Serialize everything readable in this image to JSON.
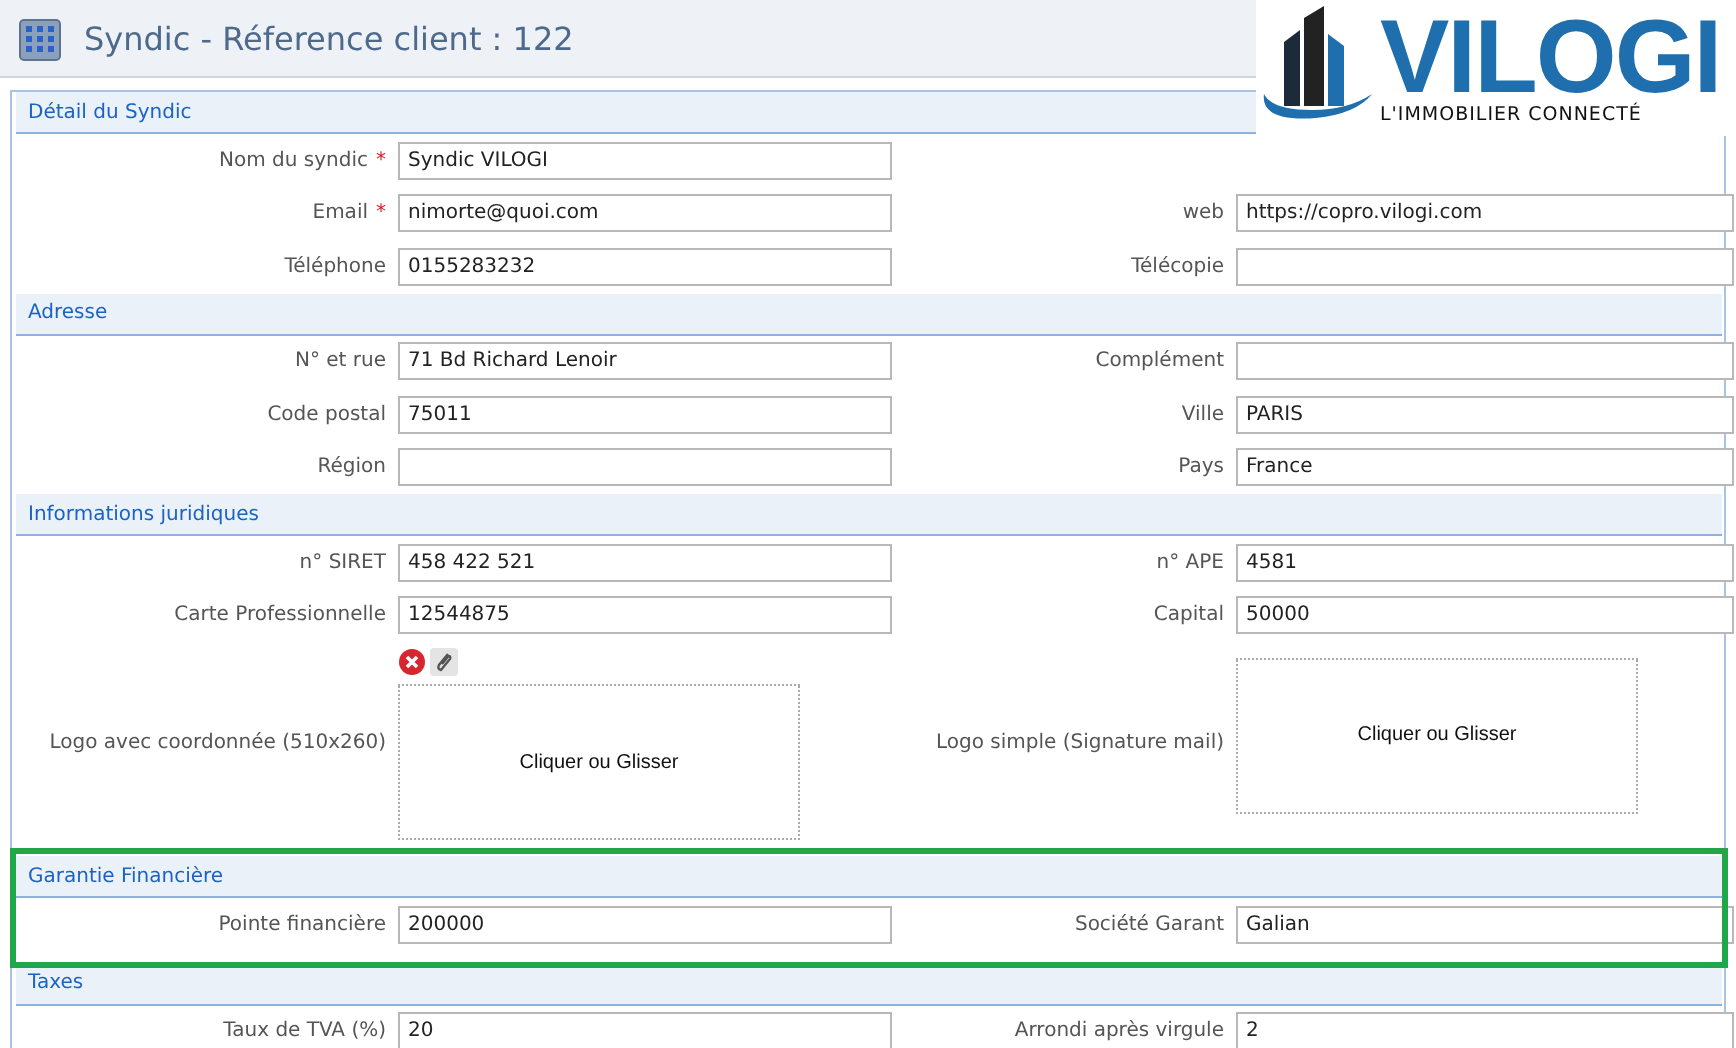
{
  "header": {
    "title": "Syndic - Réference client : 122"
  },
  "brand": {
    "name": "VILOGI",
    "tagline": "L'IMMOBILIER CONNECTÉ"
  },
  "sections": [
    {
      "title": "Détail du Syndic",
      "highlighted": false,
      "rows": [
        {
          "kind": "fields",
          "fields": [
            {
              "label": "Nom du syndic",
              "required_mark": "*",
              "value": "Syndic VILOGI"
            }
          ]
        },
        {
          "kind": "fields",
          "fields": [
            {
              "label": "Email",
              "required_mark": "*",
              "value": "nimorte@quoi.com"
            },
            {
              "label": "web",
              "value": "https://copro.vilogi.com"
            }
          ]
        },
        {
          "kind": "fields",
          "fields": [
            {
              "label": "Téléphone",
              "value": "0155283232"
            },
            {
              "label": "Télécopie"
            }
          ]
        }
      ]
    },
    {
      "title": "Adresse",
      "highlighted": false,
      "rows": [
        {
          "kind": "fields",
          "fields": [
            {
              "label": "N° et rue",
              "value": "71 Bd Richard Lenoir"
            },
            {
              "label": "Complément"
            }
          ]
        },
        {
          "kind": "fields",
          "fields": [
            {
              "label": "Code postal",
              "value": "75011"
            },
            {
              "label": "Ville",
              "value": "PARIS"
            }
          ]
        },
        {
          "kind": "fields",
          "fields": [
            {
              "label": "Région"
            },
            {
              "label": "Pays",
              "value": "France"
            }
          ]
        }
      ]
    },
    {
      "title": "Informations juridiques",
      "highlighted": false,
      "rows": [
        {
          "kind": "fields",
          "fields": [
            {
              "label": "n° SIRET",
              "value": "458 422 521"
            },
            {
              "label": "n° APE",
              "value": "4581"
            }
          ]
        },
        {
          "kind": "fields",
          "fields": [
            {
              "label": "Carte Professionnelle",
              "value": "12544875"
            },
            {
              "label": "Capital",
              "value": "50000"
            }
          ]
        },
        {
          "kind": "uploads",
          "fields": [
            {
              "label": "Logo avec coordonnée (510x260)",
              "prompt": "Cliquer ou Glisser",
              "has_file": true
            },
            {
              "label": "Logo simple (Signature mail)",
              "prompt": "Cliquer ou Glisser",
              "has_file": false
            }
          ]
        }
      ]
    },
    {
      "title": "Garantie Financière",
      "highlighted": true,
      "rows": [
        {
          "kind": "fields",
          "fields": [
            {
              "label": "Pointe financière",
              "value": "200000"
            },
            {
              "label": "Société Garant",
              "value": "Galian"
            }
          ]
        }
      ]
    },
    {
      "title": "Taxes",
      "highlighted": false,
      "rows": [
        {
          "kind": "fields",
          "fields": [
            {
              "label": "Taux de TVA (%)",
              "value": "20"
            },
            {
              "label": "Arrondi après virgule",
              "value": "2"
            }
          ]
        }
      ]
    }
  ]
}
